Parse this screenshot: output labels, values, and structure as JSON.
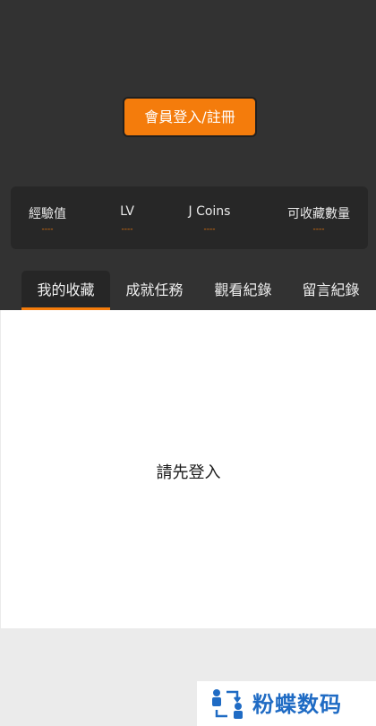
{
  "header": {
    "login_button": "會員登入/註冊"
  },
  "stats": [
    {
      "label": "經驗值",
      "value": "----"
    },
    {
      "label": "LV",
      "value": "----"
    },
    {
      "label": "J Coins",
      "value": "----"
    },
    {
      "label": "可收藏數量",
      "value": "----"
    }
  ],
  "tabs": [
    {
      "label": "我的收藏",
      "active": true
    },
    {
      "label": "成就任務",
      "active": false
    },
    {
      "label": "觀看紀錄",
      "active": false
    },
    {
      "label": "留言紀錄",
      "active": false
    }
  ],
  "content": {
    "message": "請先登入"
  },
  "watermark": {
    "text": "粉蝶数码"
  },
  "colors": {
    "accent": "#f47c0c",
    "header_bg": "#323232",
    "card_bg": "#272727",
    "watermark_blue": "#1f6bc4"
  }
}
